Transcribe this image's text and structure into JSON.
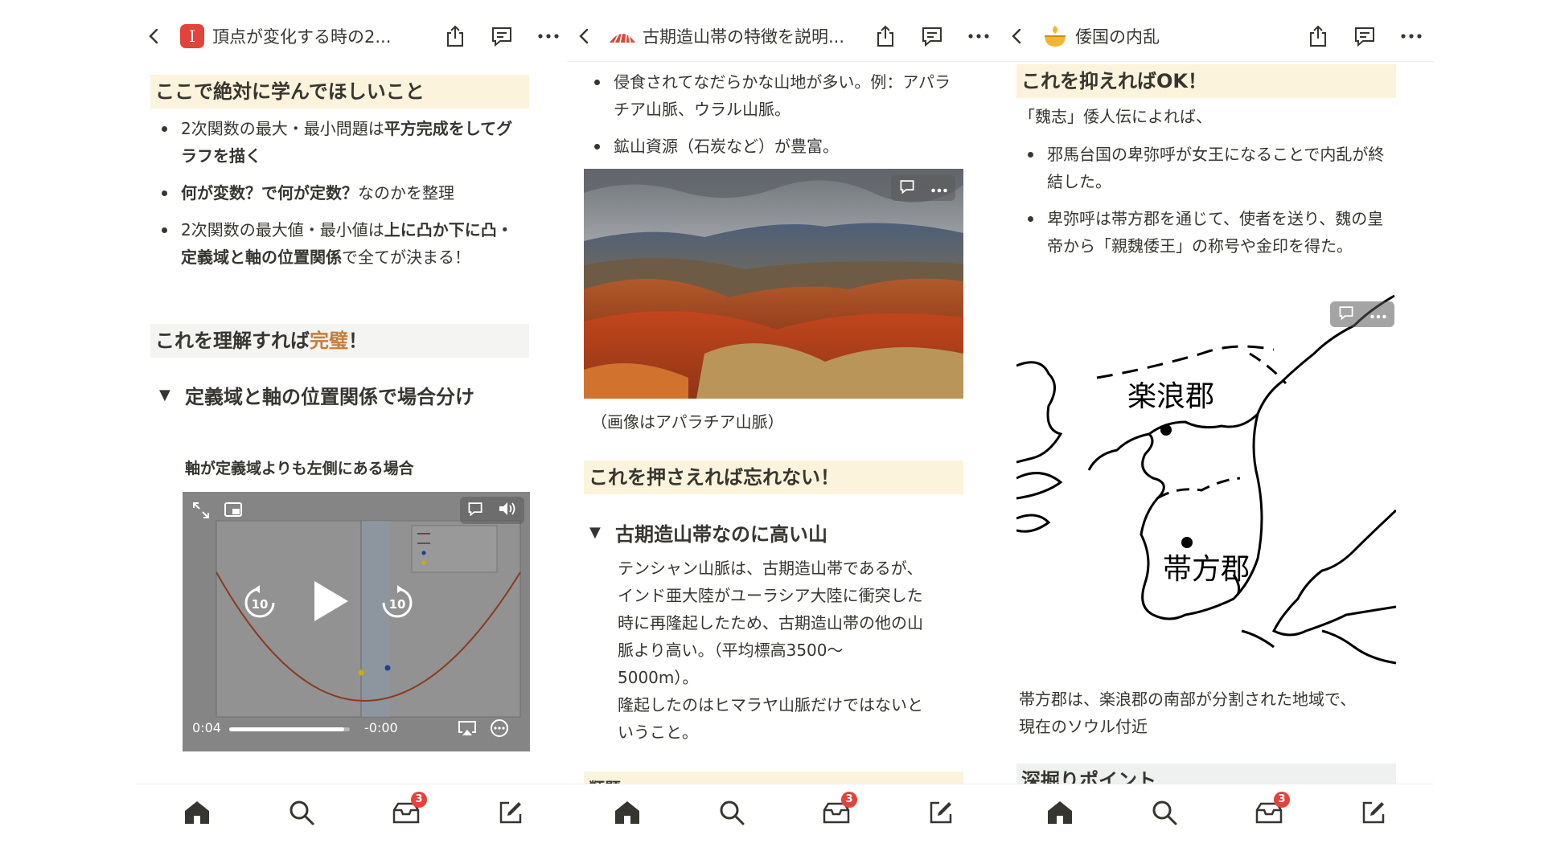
{
  "panel1": {
    "title": "頂点が変化する時の2...",
    "callout_heading": "ここで絶対に学んでほしいこと",
    "bullets": [
      {
        "a": "2次関数の最大・最小問題は",
        "b": "平方完成をしてグラフを描く",
        "c": ""
      },
      {
        "a": "",
        "b": "何が変数？で何が定数？",
        "c": "なのかを整理"
      },
      {
        "a": "2次関数の最大値・最小値は",
        "b": "上に凸か下に凸・定義域と軸の位置関係",
        "c": "で全てが決まる！"
      }
    ],
    "callout2_pre": "これを理解すれば",
    "callout2_em": "完璧",
    "callout2_post": "！",
    "toggle": "定義域と軸の位置関係で場合分け",
    "subheading": "軸が定義域よりも左側にある場合",
    "video": {
      "time_elapsed": "0:04",
      "time_remaining": "-0:00",
      "progress": 0.95,
      "skip_back": "10",
      "skip_fwd": "10"
    }
  },
  "panel2": {
    "title": "古期造山帯の特徴を説明...",
    "bullets": [
      "侵食されてなだらかな山地が多い。例：アパラチア山脈、ウラル山脈。",
      "鉱山資源（石炭など）が豊富。"
    ],
    "caption": "（画像はアパラチア山脈）",
    "callout_heading": "これを押さえれば忘れない！",
    "toggle": "古期造山帯なのに高い山",
    "body_lines": [
      "テンシャン山脈は、古期造山帯であるが、",
      "インド亜大陸がユーラシア大陸に衝突した",
      "時に再隆起したため、古期造山帯の他の山",
      "脈より高い。（平均標高3500〜",
      "5000m）。",
      "隆起したのはヒマラヤ山脈だけではないと",
      "いうこと。"
    ],
    "bottom_heading": "類題"
  },
  "panel3": {
    "title": "倭国の内乱",
    "callout_heading": "これを抑えればOK！",
    "intro": "「魏志」倭人伝によれば、",
    "bullets": [
      "邪馬台国の卑弥呼が女王になることで内乱が終結した。",
      "卑弥呼は帯方郡を通じて、使者を送り、魏の皇帝から「親魏倭王」の称号や金印を得た。"
    ],
    "map_label_1": "楽浪郡",
    "map_label_2": "帯方郡",
    "caption_lines": [
      "帯方郡は、楽浪郡の南部が分割された地域で、",
      "現在のソウル付近"
    ],
    "bottom_heading": "深掘りポイント"
  },
  "tabbar": {
    "badge": "3"
  },
  "colors": {
    "callout_bg": "#fbf3db",
    "accent": "#c77d3a",
    "badge": "#e2433b"
  }
}
